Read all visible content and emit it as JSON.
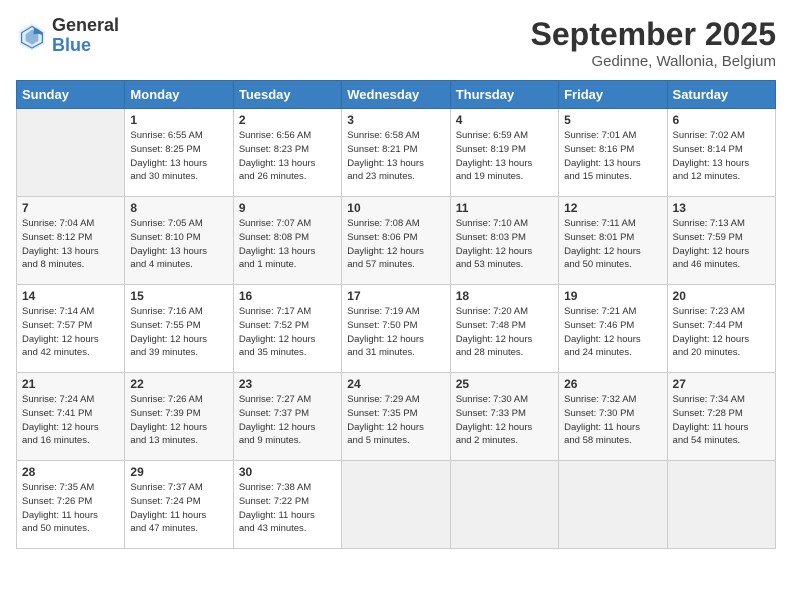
{
  "header": {
    "logo_general": "General",
    "logo_blue": "Blue",
    "month_title": "September 2025",
    "location": "Gedinne, Wallonia, Belgium"
  },
  "days_of_week": [
    "Sunday",
    "Monday",
    "Tuesday",
    "Wednesday",
    "Thursday",
    "Friday",
    "Saturday"
  ],
  "weeks": [
    [
      {
        "day": "",
        "info": ""
      },
      {
        "day": "1",
        "info": "Sunrise: 6:55 AM\nSunset: 8:25 PM\nDaylight: 13 hours\nand 30 minutes."
      },
      {
        "day": "2",
        "info": "Sunrise: 6:56 AM\nSunset: 8:23 PM\nDaylight: 13 hours\nand 26 minutes."
      },
      {
        "day": "3",
        "info": "Sunrise: 6:58 AM\nSunset: 8:21 PM\nDaylight: 13 hours\nand 23 minutes."
      },
      {
        "day": "4",
        "info": "Sunrise: 6:59 AM\nSunset: 8:19 PM\nDaylight: 13 hours\nand 19 minutes."
      },
      {
        "day": "5",
        "info": "Sunrise: 7:01 AM\nSunset: 8:16 PM\nDaylight: 13 hours\nand 15 minutes."
      },
      {
        "day": "6",
        "info": "Sunrise: 7:02 AM\nSunset: 8:14 PM\nDaylight: 13 hours\nand 12 minutes."
      }
    ],
    [
      {
        "day": "7",
        "info": "Sunrise: 7:04 AM\nSunset: 8:12 PM\nDaylight: 13 hours\nand 8 minutes."
      },
      {
        "day": "8",
        "info": "Sunrise: 7:05 AM\nSunset: 8:10 PM\nDaylight: 13 hours\nand 4 minutes."
      },
      {
        "day": "9",
        "info": "Sunrise: 7:07 AM\nSunset: 8:08 PM\nDaylight: 13 hours\nand 1 minute."
      },
      {
        "day": "10",
        "info": "Sunrise: 7:08 AM\nSunset: 8:06 PM\nDaylight: 12 hours\nand 57 minutes."
      },
      {
        "day": "11",
        "info": "Sunrise: 7:10 AM\nSunset: 8:03 PM\nDaylight: 12 hours\nand 53 minutes."
      },
      {
        "day": "12",
        "info": "Sunrise: 7:11 AM\nSunset: 8:01 PM\nDaylight: 12 hours\nand 50 minutes."
      },
      {
        "day": "13",
        "info": "Sunrise: 7:13 AM\nSunset: 7:59 PM\nDaylight: 12 hours\nand 46 minutes."
      }
    ],
    [
      {
        "day": "14",
        "info": "Sunrise: 7:14 AM\nSunset: 7:57 PM\nDaylight: 12 hours\nand 42 minutes."
      },
      {
        "day": "15",
        "info": "Sunrise: 7:16 AM\nSunset: 7:55 PM\nDaylight: 12 hours\nand 39 minutes."
      },
      {
        "day": "16",
        "info": "Sunrise: 7:17 AM\nSunset: 7:52 PM\nDaylight: 12 hours\nand 35 minutes."
      },
      {
        "day": "17",
        "info": "Sunrise: 7:19 AM\nSunset: 7:50 PM\nDaylight: 12 hours\nand 31 minutes."
      },
      {
        "day": "18",
        "info": "Sunrise: 7:20 AM\nSunset: 7:48 PM\nDaylight: 12 hours\nand 28 minutes."
      },
      {
        "day": "19",
        "info": "Sunrise: 7:21 AM\nSunset: 7:46 PM\nDaylight: 12 hours\nand 24 minutes."
      },
      {
        "day": "20",
        "info": "Sunrise: 7:23 AM\nSunset: 7:44 PM\nDaylight: 12 hours\nand 20 minutes."
      }
    ],
    [
      {
        "day": "21",
        "info": "Sunrise: 7:24 AM\nSunset: 7:41 PM\nDaylight: 12 hours\nand 16 minutes."
      },
      {
        "day": "22",
        "info": "Sunrise: 7:26 AM\nSunset: 7:39 PM\nDaylight: 12 hours\nand 13 minutes."
      },
      {
        "day": "23",
        "info": "Sunrise: 7:27 AM\nSunset: 7:37 PM\nDaylight: 12 hours\nand 9 minutes."
      },
      {
        "day": "24",
        "info": "Sunrise: 7:29 AM\nSunset: 7:35 PM\nDaylight: 12 hours\nand 5 minutes."
      },
      {
        "day": "25",
        "info": "Sunrise: 7:30 AM\nSunset: 7:33 PM\nDaylight: 12 hours\nand 2 minutes."
      },
      {
        "day": "26",
        "info": "Sunrise: 7:32 AM\nSunset: 7:30 PM\nDaylight: 11 hours\nand 58 minutes."
      },
      {
        "day": "27",
        "info": "Sunrise: 7:34 AM\nSunset: 7:28 PM\nDaylight: 11 hours\nand 54 minutes."
      }
    ],
    [
      {
        "day": "28",
        "info": "Sunrise: 7:35 AM\nSunset: 7:26 PM\nDaylight: 11 hours\nand 50 minutes."
      },
      {
        "day": "29",
        "info": "Sunrise: 7:37 AM\nSunset: 7:24 PM\nDaylight: 11 hours\nand 47 minutes."
      },
      {
        "day": "30",
        "info": "Sunrise: 7:38 AM\nSunset: 7:22 PM\nDaylight: 11 hours\nand 43 minutes."
      },
      {
        "day": "",
        "info": ""
      },
      {
        "day": "",
        "info": ""
      },
      {
        "day": "",
        "info": ""
      },
      {
        "day": "",
        "info": ""
      }
    ]
  ]
}
